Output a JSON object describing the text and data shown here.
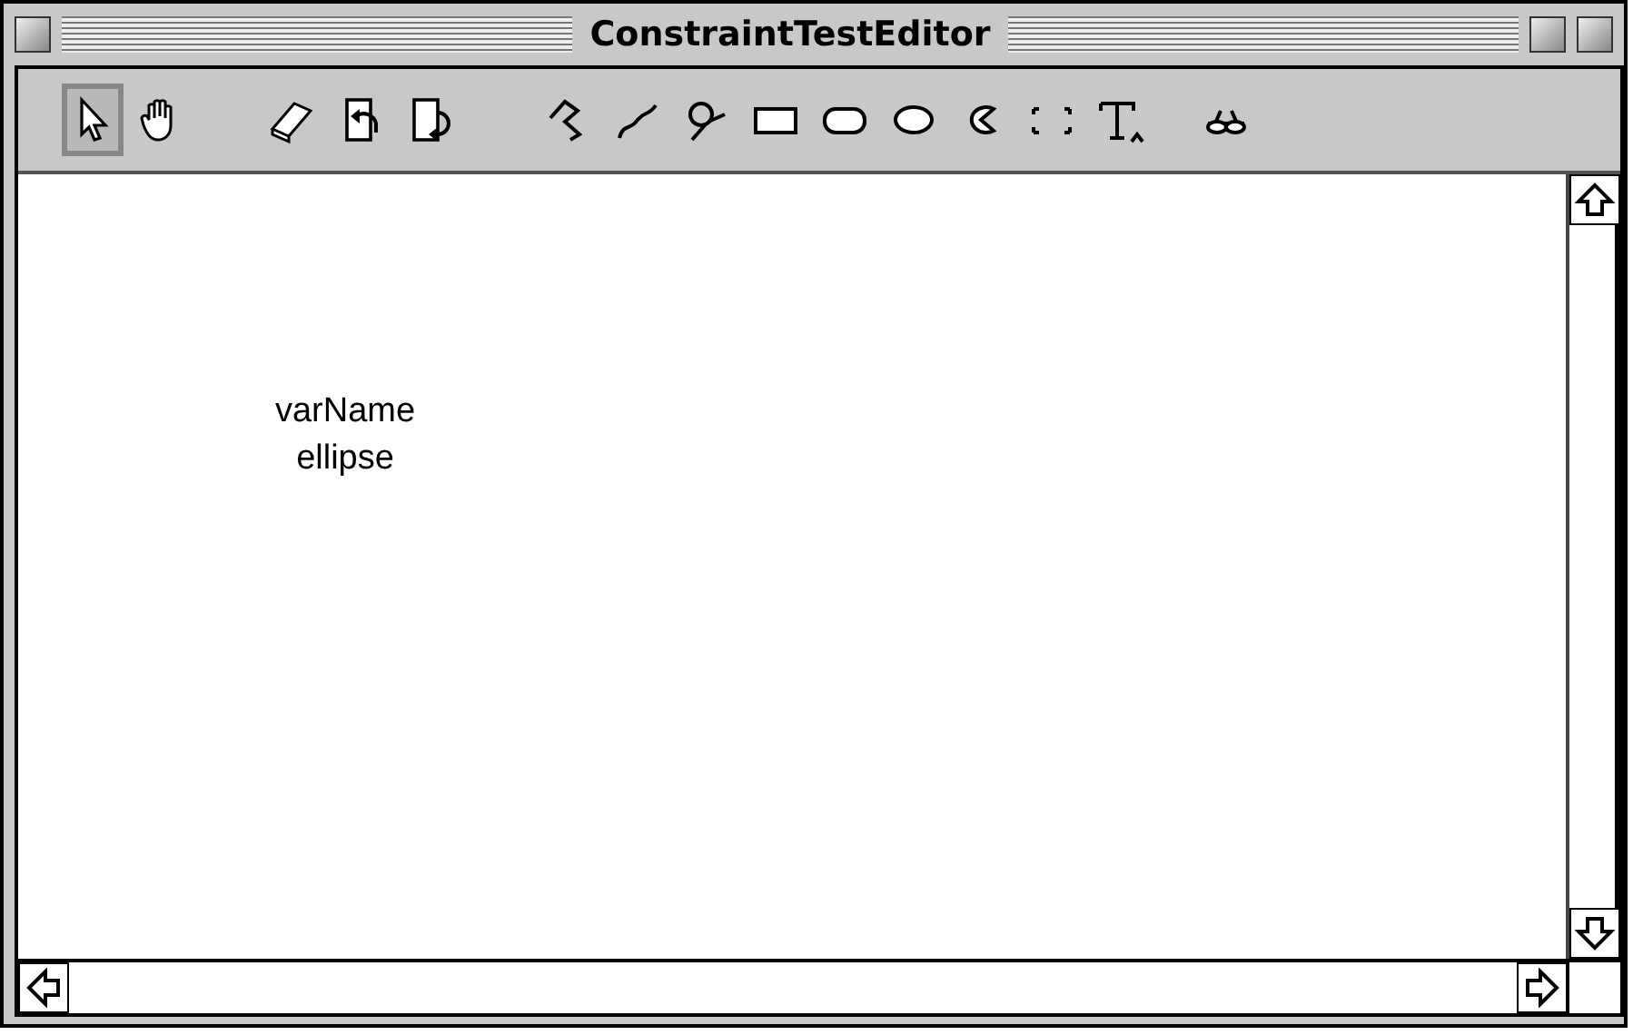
{
  "window": {
    "title": "ConstraintTestEditor"
  },
  "tools": [
    {
      "kind": "pointer",
      "selected": true
    },
    {
      "kind": "hand",
      "selected": false
    },
    {
      "kind": "eraser",
      "selected": false
    },
    {
      "kind": "doc-left",
      "selected": false
    },
    {
      "kind": "doc-right",
      "selected": false
    },
    {
      "kind": "polygon",
      "selected": false
    },
    {
      "kind": "curve",
      "selected": false
    },
    {
      "kind": "lasso",
      "selected": false
    },
    {
      "kind": "rectangle",
      "selected": false
    },
    {
      "kind": "rounded-rect",
      "selected": false
    },
    {
      "kind": "ellipse",
      "selected": false
    },
    {
      "kind": "arc",
      "selected": false
    },
    {
      "kind": "frame",
      "selected": false
    },
    {
      "kind": "text",
      "selected": false
    },
    {
      "kind": "glasses",
      "selected": false
    }
  ],
  "canvas": {
    "label": {
      "lines": [
        "varName",
        "ellipse"
      ]
    }
  }
}
